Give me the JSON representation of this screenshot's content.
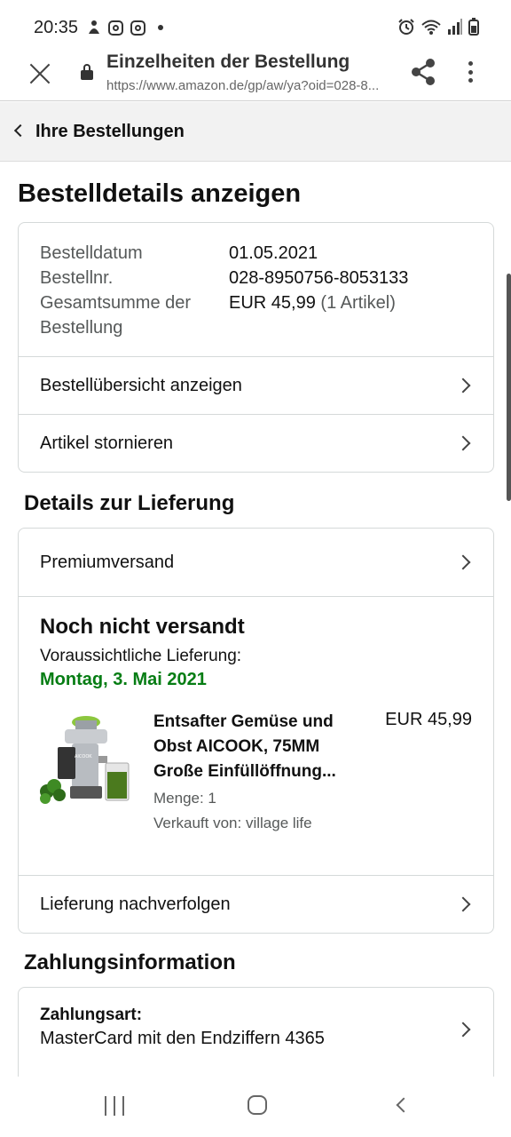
{
  "status": {
    "time": "20:35"
  },
  "browser": {
    "page_title": "Einzelheiten der Bestellung",
    "url": "https://www.amazon.de/gp/aw/ya?oid=028-8..."
  },
  "breadcrumb": {
    "label": "Ihre Bestellungen"
  },
  "heading": "Bestelldetails anzeigen",
  "summary": {
    "date_label": "Bestelldatum",
    "date_value": "01.05.2021",
    "number_label": "Bestellnr.",
    "number_value": "028-8950756-8053133",
    "total_label_line1": "Gesamtsumme der",
    "total_label_line2": "Bestellung",
    "total_value": "EUR 45,99",
    "total_items": "(1 Artikel)"
  },
  "actions": {
    "overview": "Bestellübersicht anzeigen",
    "cancel": "Artikel stornieren"
  },
  "delivery": {
    "section_title": "Details zur Lieferung",
    "shipping_method": "Premiumversand",
    "status": "Noch nicht versandt",
    "expected_label": "Voraussichtliche Lieferung:",
    "expected_date": "Montag, 3. Mai 2021",
    "product": {
      "name": "Entsafter Gemüse und Obst AICOOK, 75MM Große Einfüllöffnung...",
      "price": "EUR 45,99",
      "quantity": "Menge: 1",
      "seller": "Verkauft von: village life",
      "image_brand": "AICOOK"
    },
    "track": "Lieferung nachverfolgen"
  },
  "payment": {
    "section_title": "Zahlungsinformation",
    "method_label": "Zahlungsart:",
    "method_value": "MasterCard mit den Endziffern 4365"
  },
  "colors": {
    "green_date": "#067d14",
    "card_border": "#d5d9d9",
    "breadcrumb_bg": "#f2f2f2"
  }
}
